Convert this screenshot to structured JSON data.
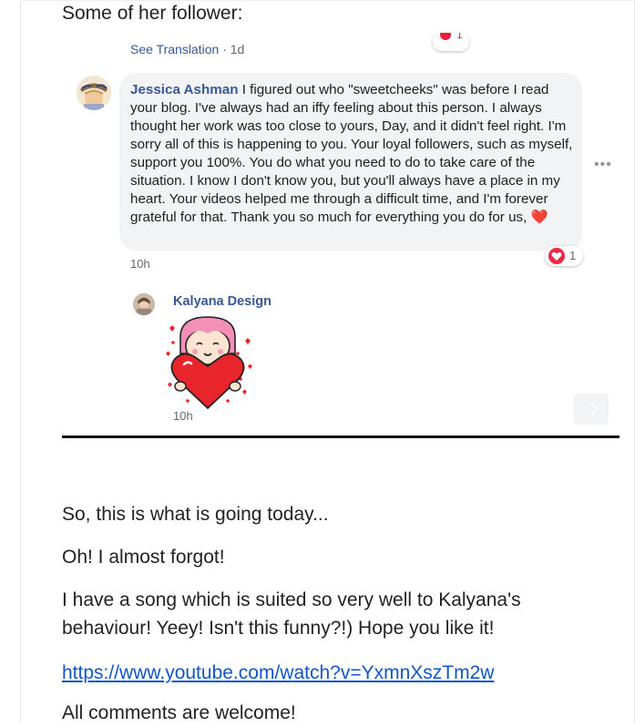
{
  "intro_text": "Some of her follower:",
  "translation": {
    "label": "See Translation",
    "separator": "·",
    "time": "1d"
  },
  "top_reaction": {
    "count": "1"
  },
  "comment": {
    "author": "Jessica Ashman",
    "text": " I figured out who \"sweetcheeks\" was before I read your blog. I've always had an iffy feeling about this person. I always thought her work was too close to yours, Day, and it didn't feel right. I'm sorry all of this is happening to you. Your loyal followers, such as myself, support you 100%. You do what you need to do to take care of the situation. I know I don't know you, but you'll always have a place in my heart. Your videos helped me through a difficult time, and I'm forever grateful for that. Thank you so much for everything you do for us, ",
    "emoji": "❤️",
    "reaction_count": "1",
    "time": "10h",
    "more": "•••"
  },
  "reply": {
    "author": "Kalyana Design",
    "time": "10h"
  },
  "article": {
    "p1": "So, this is what is going today...",
    "p2": "Oh! I almost forgot!",
    "p3": "I have a song which is suited so very well to Kalyana's behaviour! Yeey! Isn't this funny?!) Hope you like it!",
    "link": "https://www.youtube.com/watch?v=YxmnXszTm2w",
    "p5": "All comments are welcome!"
  },
  "colors": {
    "link": "#1155cc",
    "author": "#385898",
    "bubble": "#f2f3f5",
    "heart": "#e41e3f"
  }
}
